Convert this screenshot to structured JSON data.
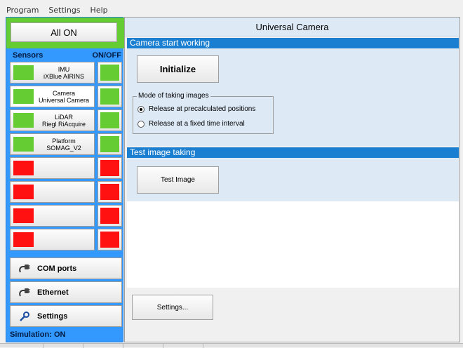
{
  "menu": [
    "Program",
    "Settings",
    "Help"
  ],
  "left": {
    "all_on_label": "All ON",
    "sensors_header": "Sensors",
    "onoff_header": "ON/OFF",
    "sensors": [
      {
        "line1": "IMU",
        "line2": "iXBlue AIRINS",
        "status": "green",
        "onoff": "green",
        "selected": false
      },
      {
        "line1": "Camera",
        "line2": "Universal Camera",
        "status": "green",
        "onoff": "green",
        "selected": true
      },
      {
        "line1": "LiDAR",
        "line2": "Riegl RiAcquire",
        "status": "green",
        "onoff": "green",
        "selected": false
      },
      {
        "line1": "Platform",
        "line2": "SOMAG_V2",
        "status": "green",
        "onoff": "green",
        "selected": false
      },
      {
        "line1": "",
        "line2": "",
        "status": "red",
        "onoff": "red",
        "selected": false
      },
      {
        "line1": "",
        "line2": "",
        "status": "red",
        "onoff": "red",
        "selected": false
      },
      {
        "line1": "",
        "line2": "",
        "status": "red",
        "onoff": "red",
        "selected": false
      },
      {
        "line1": "",
        "line2": "",
        "status": "red",
        "onoff": "red",
        "selected": false
      }
    ],
    "com_ports_label": "COM ports",
    "ethernet_label": "Ethernet",
    "settings_label": "Settings",
    "simulation_status": "Simulation: ON"
  },
  "right": {
    "title": "Universal Camera",
    "section1_header": "Camera start working",
    "initialize_label": "Initialize",
    "mode_legend": "Mode of taking images",
    "mode_options": [
      {
        "label": "Release at precalculated positions",
        "checked": true
      },
      {
        "label": "Release at a fixed time interval",
        "checked": false
      }
    ],
    "section2_header": "Test image taking",
    "test_image_label": "Test Image",
    "settings_label": "Settings..."
  },
  "colors": {
    "panel_blue": "#3399ff",
    "indicator_green": "#66cc33",
    "indicator_red": "#ff1111",
    "section_header_blue": "#1b7fd1",
    "section_body": "#dde9f5"
  },
  "icons": {
    "com_ports": "cable-plug-icon",
    "ethernet": "cable-plug-icon",
    "settings": "wrench-icon"
  }
}
